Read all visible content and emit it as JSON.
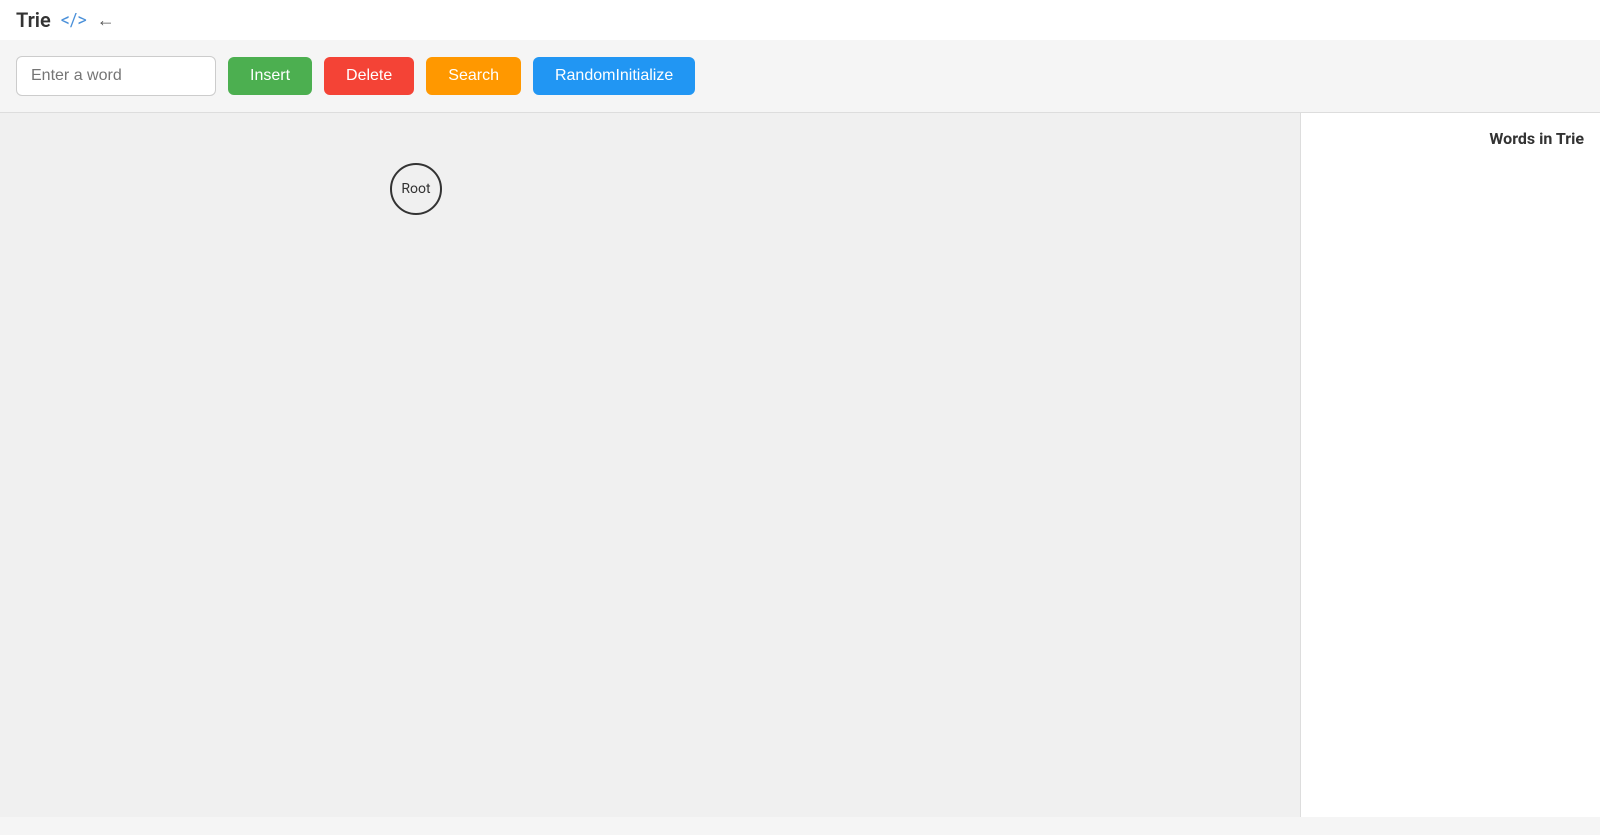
{
  "header": {
    "title": "Trie",
    "code_icon": "</>",
    "back_icon": "←"
  },
  "toolbar": {
    "input_placeholder": "Enter a word",
    "insert_label": "Insert",
    "delete_label": "Delete",
    "search_label": "Search",
    "random_label": "RandomInitialize"
  },
  "trie": {
    "root_label": "Root"
  },
  "sidebar": {
    "title": "Words in Trie"
  }
}
